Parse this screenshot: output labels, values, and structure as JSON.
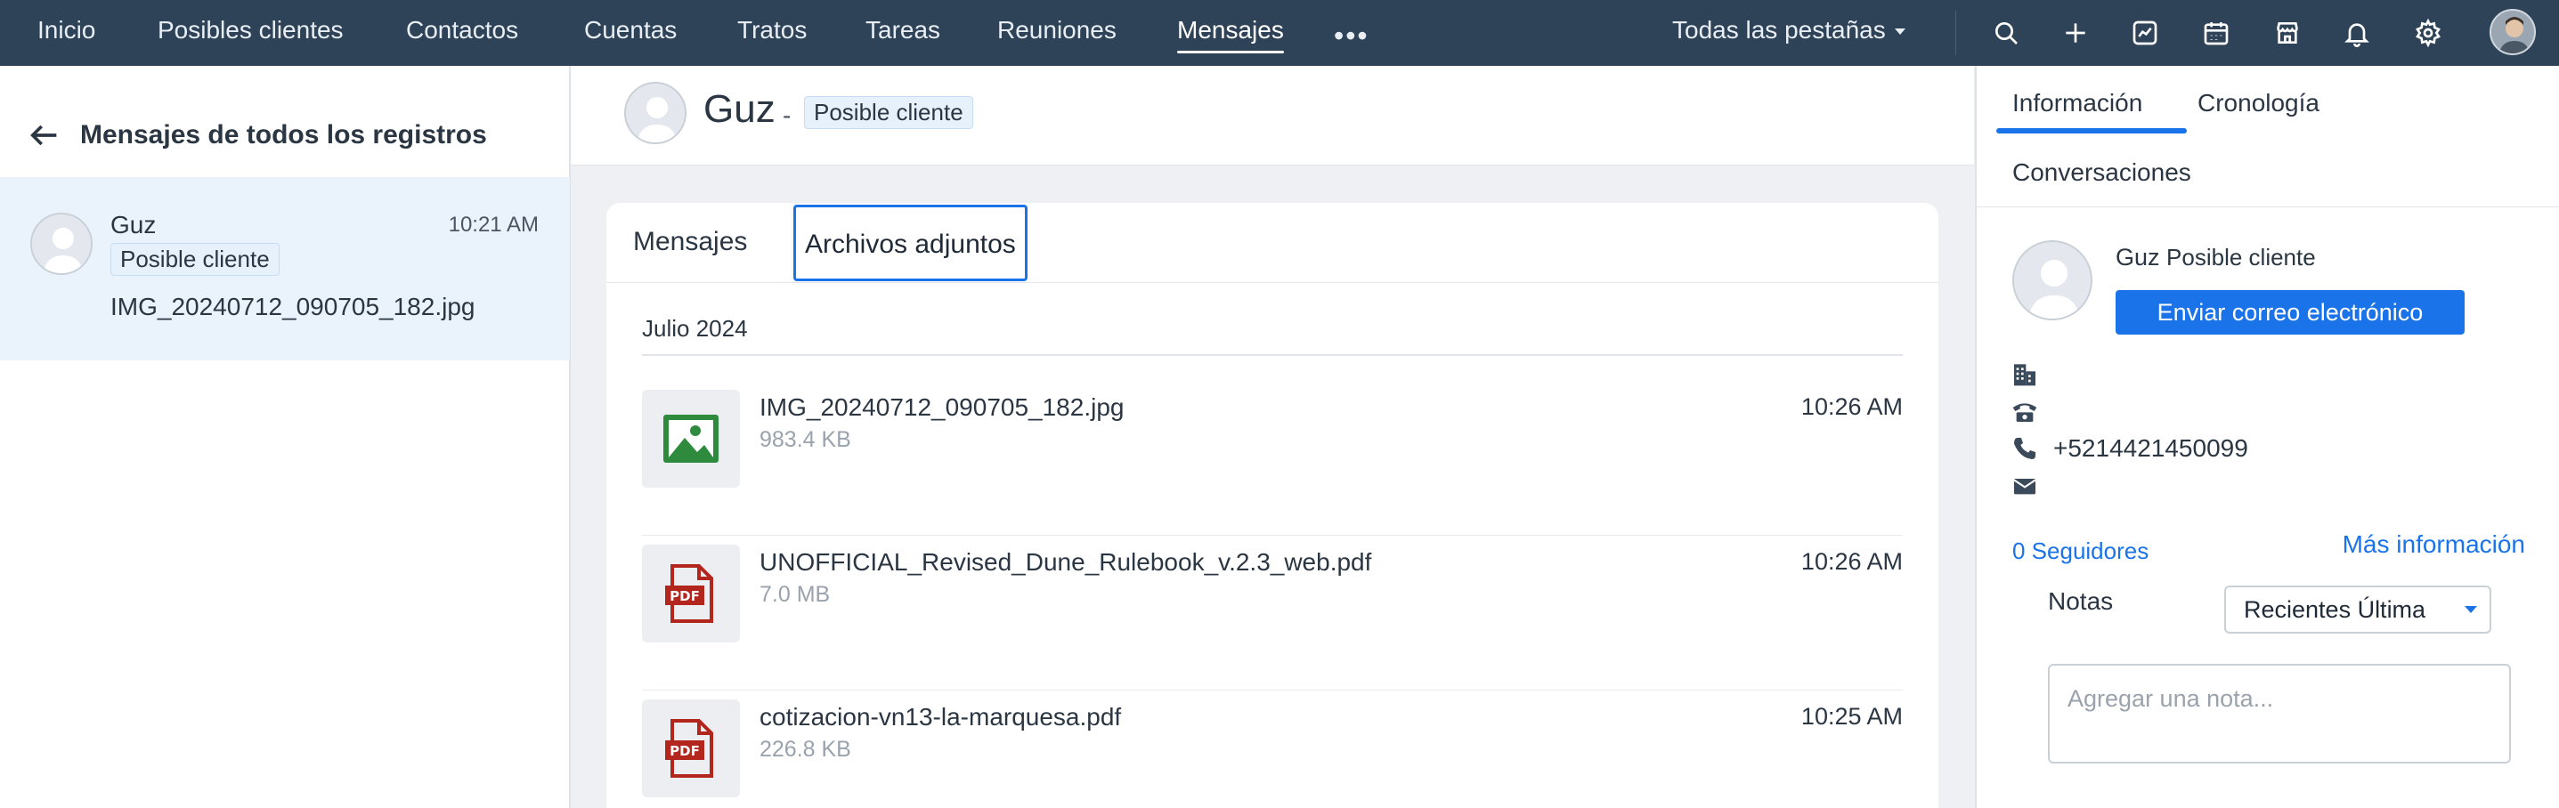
{
  "nav": {
    "items": [
      {
        "label": "Inicio"
      },
      {
        "label": "Posibles clientes"
      },
      {
        "label": "Contactos"
      },
      {
        "label": "Cuentas"
      },
      {
        "label": "Tratos"
      },
      {
        "label": "Tareas"
      },
      {
        "label": "Reuniones"
      },
      {
        "label": "Mensajes",
        "active": true
      }
    ],
    "more_icon": "more-dots-icon",
    "all_tabs_label": "Todas las pestañas",
    "icons": [
      "search-icon",
      "plus-icon",
      "analytics-icon",
      "calendar-icon",
      "marketplace-icon",
      "bell-icon",
      "gear-icon"
    ],
    "bg_color": "#2e4358"
  },
  "left": {
    "title": "Mensajes de todos los registros",
    "conversation": {
      "name": "Guz",
      "badge": "Posible cliente",
      "time": "10:21 AM",
      "last_message": "IMG_20240712_090705_182.jpg"
    }
  },
  "center": {
    "record_name": "Guz",
    "separator": "-",
    "record_badge": "Posible cliente",
    "tabs": {
      "messages": "Mensajes",
      "attachments": "Archivos adjuntos"
    },
    "month": "Julio 2024",
    "files": [
      {
        "name": "IMG_20240712_090705_182.jpg",
        "size": "983.4 KB",
        "time": "10:26 AM",
        "icon": "image-file-icon"
      },
      {
        "name": "UNOFFICIAL_Revised_Dune_Rulebook_v.2.3_web.pdf",
        "size": "7.0 MB",
        "time": "10:26 AM",
        "icon": "pdf-file-icon"
      },
      {
        "name": "cotizacion-vn13-la-marquesa.pdf",
        "size": "226.8 KB",
        "time": "10:25 AM",
        "icon": "pdf-file-icon"
      }
    ]
  },
  "right": {
    "tabs": {
      "info": "Información",
      "timeline": "Cronología",
      "conversations": "Conversaciones"
    },
    "contact_name": "Guz",
    "contact_type": "Posible cliente",
    "send_email": "Enviar correo electrónico",
    "phone": "+5214421450099",
    "followers": "0 Seguidores",
    "more_info": "Más información",
    "notes_label": "Notas",
    "sort_value": "Recientes Última",
    "note_placeholder": "Agregar una nota...",
    "accent_color": "#1a73e8"
  }
}
